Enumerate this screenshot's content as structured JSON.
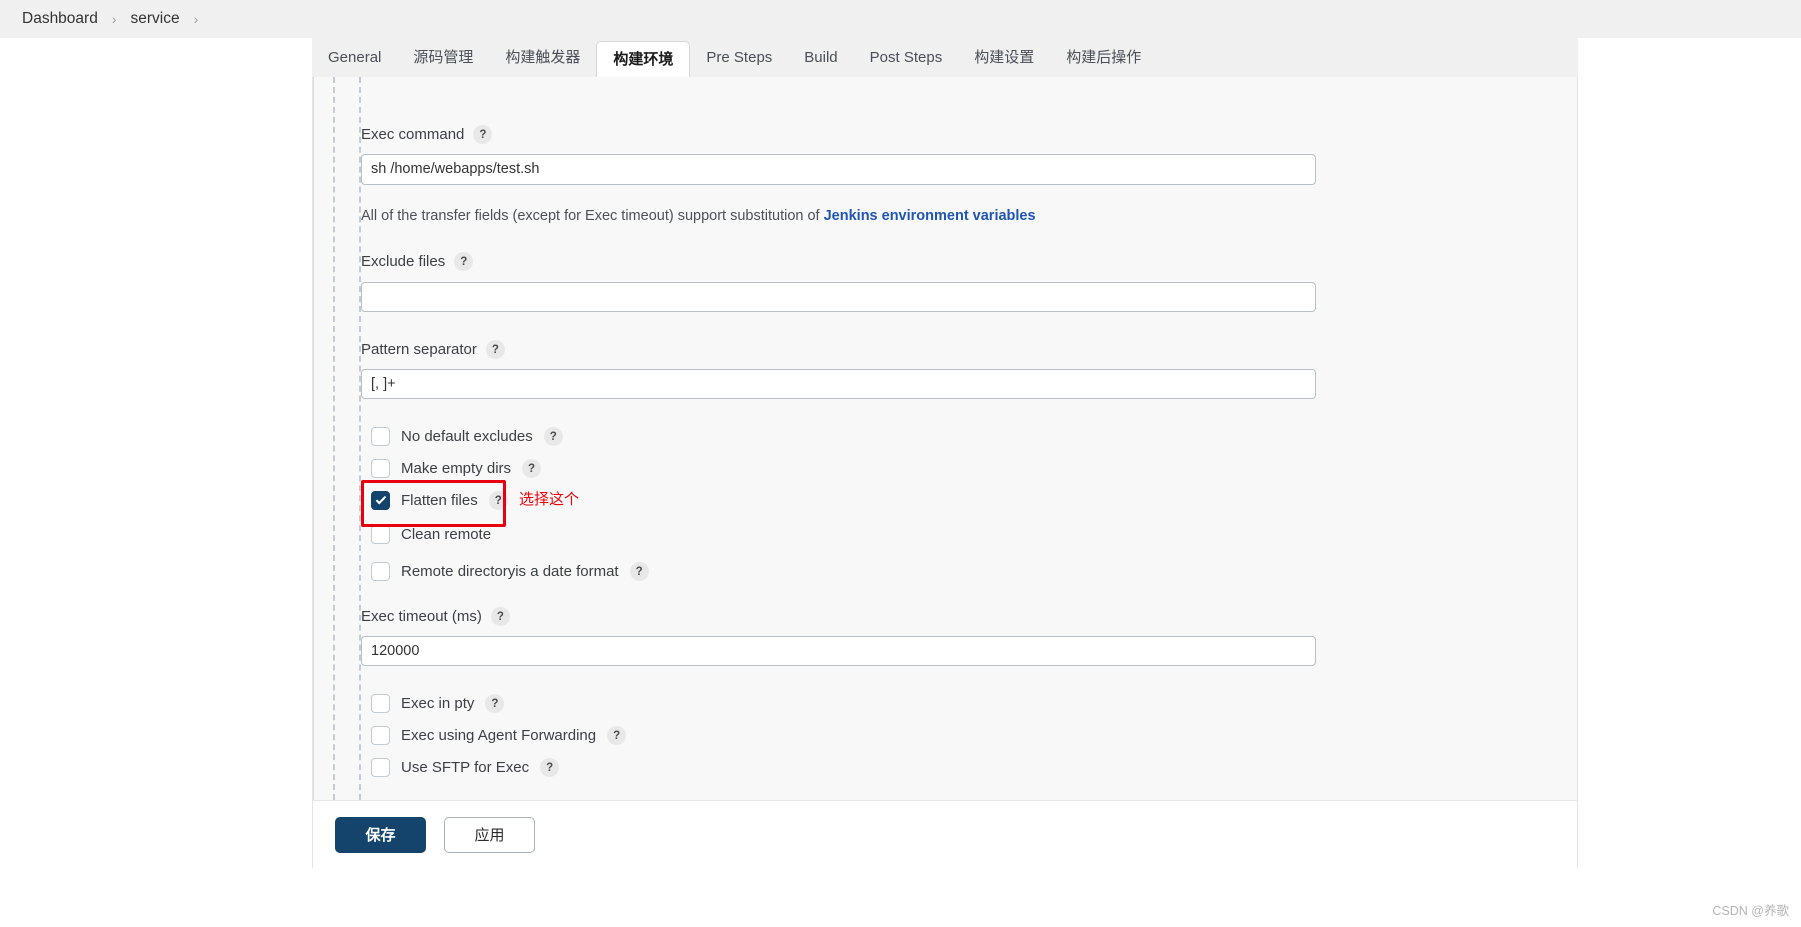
{
  "breadcrumb": {
    "items": [
      {
        "label": "Dashboard"
      },
      {
        "label": "service"
      }
    ],
    "separator": "›"
  },
  "tabs": [
    {
      "label": "General",
      "active": false
    },
    {
      "label": "源码管理",
      "active": false
    },
    {
      "label": "构建触发器",
      "active": false
    },
    {
      "label": "构建环境",
      "active": true
    },
    {
      "label": "Pre Steps",
      "active": false
    },
    {
      "label": "Build",
      "active": false
    },
    {
      "label": "Post Steps",
      "active": false
    },
    {
      "label": "构建设置",
      "active": false
    },
    {
      "label": "构建后操作",
      "active": false
    }
  ],
  "form": {
    "exec_command": {
      "label": "Exec command",
      "help": "?",
      "value": "sh /home/webapps/test.sh",
      "placeholder": ""
    },
    "helper_note": {
      "prefix": "All of the transfer fields (except for Exec timeout) support substitution of ",
      "link": "Jenkins environment variables"
    },
    "exclude_files": {
      "label": "Exclude files",
      "help": "?",
      "value": "",
      "placeholder": ""
    },
    "pattern_separator": {
      "label": "Pattern separator",
      "help": "?",
      "value": "[, ]+",
      "placeholder": ""
    },
    "checkboxes_group_1": [
      {
        "label": "No default excludes",
        "help": "?",
        "checked": false,
        "has_help": true
      },
      {
        "label": "Make empty dirs",
        "help": "?",
        "checked": false,
        "has_help": true
      },
      {
        "label": "Flatten files",
        "help": "?",
        "checked": true,
        "has_help": true
      },
      {
        "label": "Clean remote",
        "help": "",
        "checked": false,
        "has_help": false
      },
      {
        "label": "Remote directoryis a date format",
        "help": "?",
        "checked": false,
        "has_help": true
      }
    ],
    "exec_timeout": {
      "label": "Exec timeout (ms)",
      "help": "?",
      "value": "120000",
      "placeholder": ""
    },
    "checkboxes_group_2": [
      {
        "label": "Exec in pty",
        "help": "?",
        "checked": false,
        "has_help": true
      },
      {
        "label": "Exec using Agent Forwarding",
        "help": "?",
        "checked": false,
        "has_help": true
      },
      {
        "label": "Use SFTP for Exec",
        "help": "?",
        "checked": false,
        "has_help": true
      }
    ]
  },
  "annotation": {
    "text": "选择这个",
    "color": "#ef0007"
  },
  "footer": {
    "save_label": "保存",
    "apply_label": "应用"
  },
  "watermark": "CSDN @养歌",
  "colors": {
    "accent": "#14446b",
    "link": "#1f55b5",
    "annotation": "#e8000d",
    "panel_bg": "#f8f8f8",
    "header_bg": "#f0f0f0"
  }
}
